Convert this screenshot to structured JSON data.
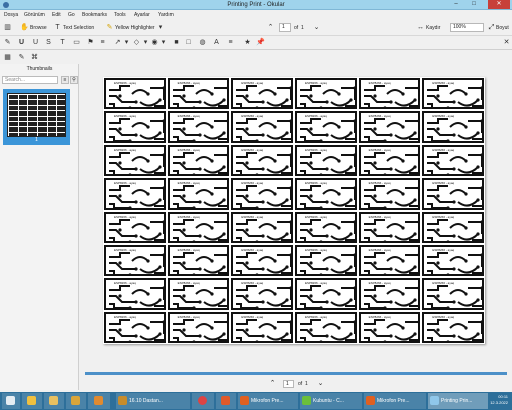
{
  "window": {
    "title": "Printing Print - Okular",
    "buttons": {
      "minimize": "–",
      "maximize": "□",
      "close": "✕"
    }
  },
  "menu": [
    "Dosya",
    "Görünüm",
    "Edit",
    "Go",
    "Bookmarks",
    "Tools",
    "Ayarlar",
    "Yardım"
  ],
  "toolbar": {
    "browse": "Browse",
    "text_selection": "Text Selection",
    "yellow_highlighter": "Yellow Highlighter",
    "page_current": "1",
    "page_of": "of",
    "page_total": "1",
    "fit_label": "Kaydır",
    "zoom": "100%",
    "fullscreen": "Boyut"
  },
  "sidebar": {
    "header": "Thumbnails",
    "search_placeholder": "Search...",
    "thumb_page": "1"
  },
  "bottom": {
    "page_current": "1",
    "page_of": "of",
    "page_total": "1"
  },
  "pcb": {
    "label": "ESP8266 - ayaq",
    "columns": 6,
    "rows": 8
  },
  "taskbar": {
    "tasks": [
      {
        "label": ""
      },
      {
        "label": ""
      },
      {
        "label": ""
      },
      {
        "label": "16.10 Dastan..."
      },
      {
        "label": ""
      },
      {
        "label": ""
      },
      {
        "label": "Mikrofon Pre..."
      },
      {
        "label": "Kubuntu - C..."
      },
      {
        "label": "Mikrofon Pre..."
      },
      {
        "label": "Printing Prin..."
      }
    ],
    "time": "00:11",
    "date": "12.3.2022"
  },
  "colors": {
    "titlebar": "#9fd3ec",
    "taskbar": "#2d6f9a",
    "selection": "#3b95d8",
    "close": "#c7403a"
  }
}
